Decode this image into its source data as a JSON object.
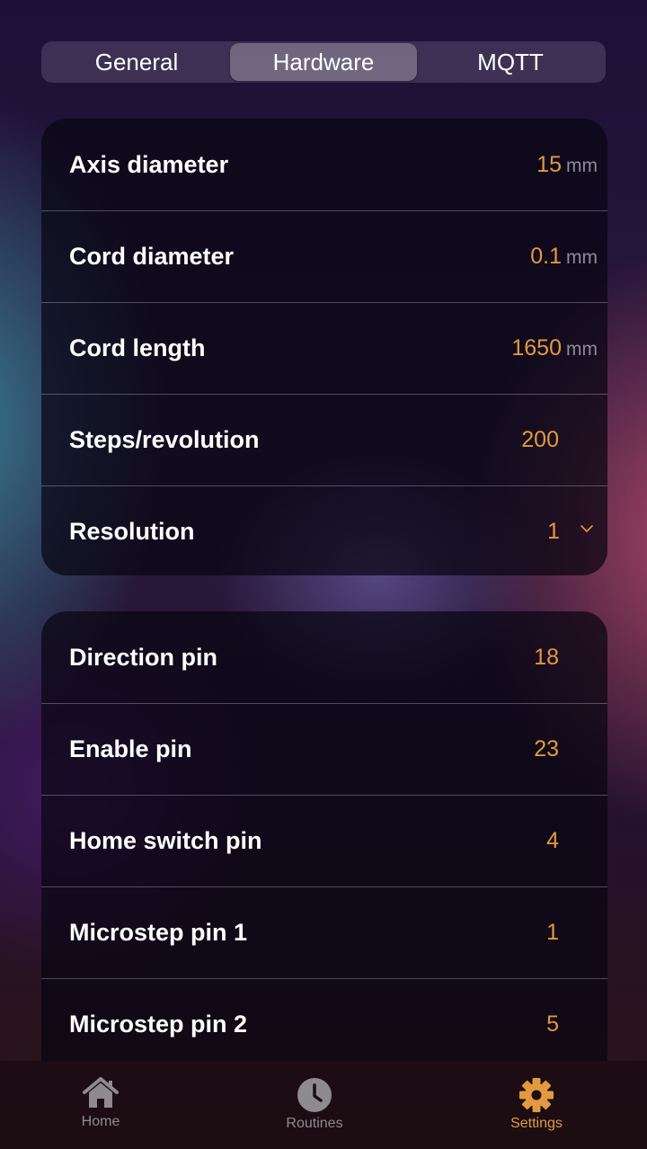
{
  "tabs": {
    "items": [
      {
        "label": "General"
      },
      {
        "label": "Hardware"
      },
      {
        "label": "MQTT"
      }
    ],
    "selected": "Hardware"
  },
  "motor_settings": {
    "axis_diameter": {
      "label": "Axis diameter",
      "value": "15",
      "unit": "mm"
    },
    "cord_diameter": {
      "label": "Cord diameter",
      "value": "0.1",
      "unit": "mm"
    },
    "cord_length": {
      "label": "Cord length",
      "value": "1650",
      "unit": "mm"
    },
    "steps_per_revolution": {
      "label": "Steps/revolution",
      "value": "200"
    },
    "resolution": {
      "label": "Resolution",
      "value": "1"
    }
  },
  "pin_settings": {
    "direction_pin": {
      "label": "Direction pin",
      "value": "18"
    },
    "enable_pin": {
      "label": "Enable pin",
      "value": "23"
    },
    "home_switch_pin": {
      "label": "Home switch pin",
      "value": "4"
    },
    "microstep_pin_1": {
      "label": "Microstep pin 1",
      "value": "1"
    },
    "microstep_pin_2": {
      "label": "Microstep pin 2",
      "value": "5"
    }
  },
  "tab_bar": {
    "home": {
      "label": "Home",
      "icon": "house-icon"
    },
    "routines": {
      "label": "Routines",
      "icon": "clock-icon"
    },
    "settings": {
      "label": "Settings",
      "icon": "gear-icon"
    },
    "active": "Settings"
  },
  "colors": {
    "accent": "#e2993f",
    "inactive": "#8e8a90",
    "card_background": "#0b0714"
  }
}
